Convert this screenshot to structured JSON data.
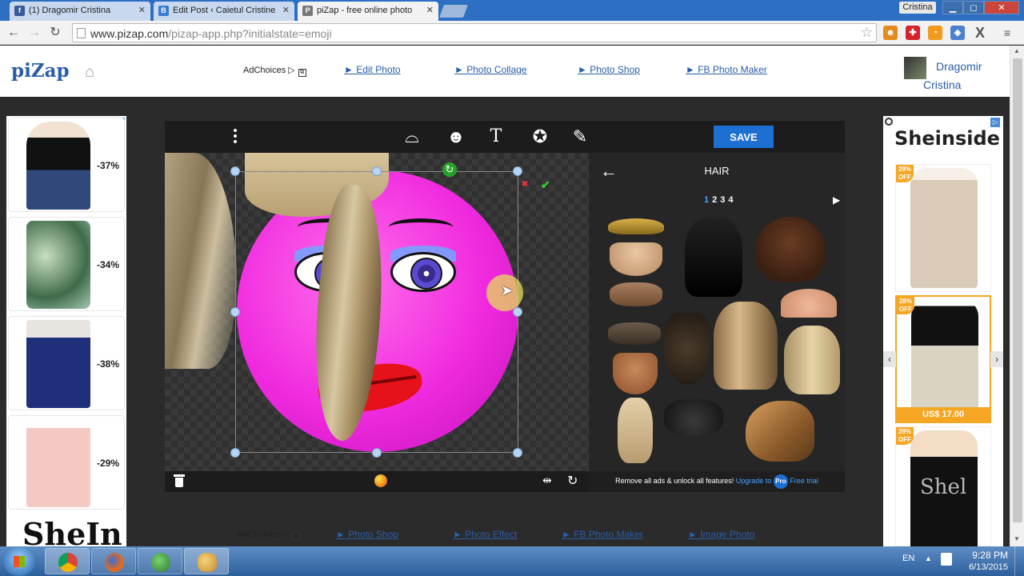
{
  "browser": {
    "tabs": [
      {
        "label": "(1) Dragomir Cristina",
        "favicon": "f",
        "favicon_color": "#3b5998"
      },
      {
        "label": "Edit Post ‹ Caietul Cristine",
        "favicon": "B",
        "favicon_color": "#3a7bd5"
      },
      {
        "label": "piZap - free online photo",
        "favicon": "P",
        "favicon_color": "#777777"
      }
    ],
    "window_user": "Cristina",
    "window_buttons": [
      "▁",
      "◻",
      "✕"
    ],
    "url": "www.pizap.com/pizap-app.php?initialstate=emoji",
    "url_host": "www.pizap.com",
    "url_path": "/pizap-app.php?initialstate=emoji"
  },
  "header": {
    "logo": "piZap",
    "adchoices": "AdChoices",
    "links": [
      "► Edit Photo",
      "► Photo Collage",
      "► Photo Shop",
      "► FB Photo Maker"
    ],
    "user_first": "Dragomir",
    "user_last": "Cristina"
  },
  "left_ad": {
    "discounts": [
      "-37%",
      "-34%",
      "-38%",
      "-29%"
    ],
    "brand": "SheIn"
  },
  "right_ad": {
    "brand": "Sheinside",
    "items": [
      {
        "badge_pct": "29%",
        "badge_off": "OFF"
      },
      {
        "badge_pct": "28%",
        "badge_off": "OFF",
        "price": "US$ 17.00"
      },
      {
        "badge_pct": "29%",
        "badge_off": "OFF"
      }
    ],
    "watermark": "Shel"
  },
  "editor": {
    "save_label": "SAVE",
    "tools": [
      "hair-tool",
      "face-tool",
      "text-tool",
      "sticker-tool",
      "paint-tool"
    ],
    "text_tool_label": "T",
    "panel": {
      "title": "HAIR",
      "pages": [
        "1",
        "2",
        "3",
        "4"
      ],
      "current_page": "1",
      "promo_text": "Remove all ads & unlock all features!",
      "promo_upgrade": "Upgrade to",
      "promo_pro": "Pro",
      "promo_trial": "Free trial"
    },
    "colors": {
      "save": "#1e6fd2",
      "emoji": "#f02adf",
      "lips": "#e5121a",
      "accent_link": "#4aa3ff"
    }
  },
  "bottom": {
    "adchoices": "AdChoices",
    "links": [
      "► Photo Shop",
      "► Photo Effect",
      "► FB Photo Maker",
      "► Image Photo"
    ]
  },
  "taskbar": {
    "apps": [
      "chrome",
      "firefox",
      "globe",
      "paint"
    ],
    "lang": "EN",
    "time": "9:28 PM",
    "date": "6/13/2015"
  }
}
